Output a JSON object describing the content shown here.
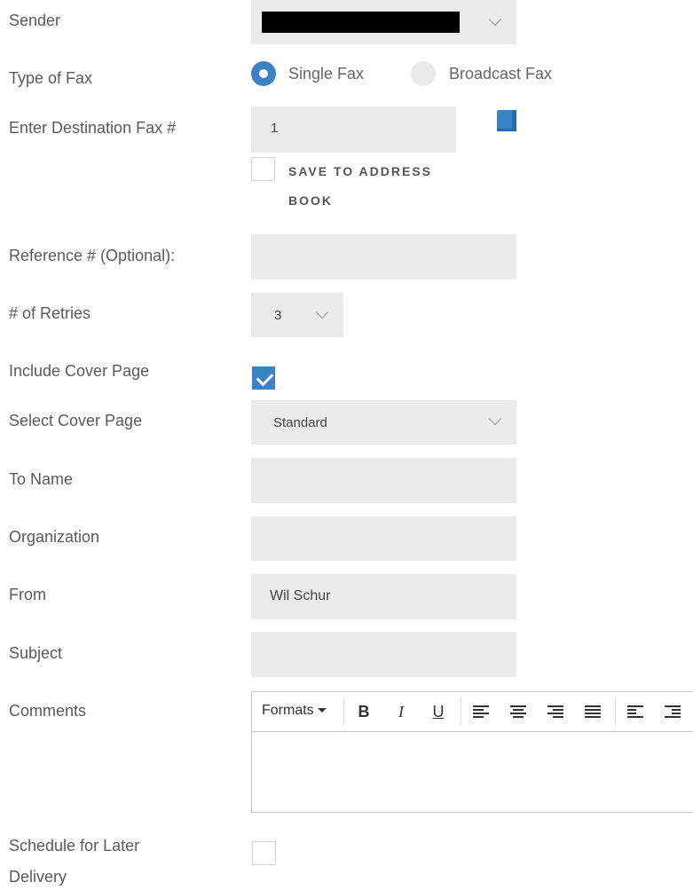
{
  "form": {
    "sender_label": "Sender",
    "fax_type_label": "Type of Fax",
    "single_fax_label": "Single Fax",
    "broadcast_fax_label": "Broadcast Fax",
    "destination_label": "Enter Destination Fax #",
    "destination_value": "1",
    "save_to_address_book_line1": "SAVE TO ADDRESS",
    "save_to_address_book_line2": "BOOK",
    "reference_label": "Reference # (Optional):",
    "reference_value": "",
    "retries_label": "# of Retries",
    "retries_value": "3",
    "include_cover_label": "Include Cover Page",
    "include_cover_checked": true,
    "select_cover_label": "Select Cover Page",
    "select_cover_value": "Standard",
    "to_name_label": "To Name",
    "to_name_value": "",
    "organization_label": "Organization",
    "organization_value": "",
    "from_label": "From",
    "from_value": "Wil Schur",
    "subject_label": "Subject",
    "subject_value": "",
    "comments_label": "Comments",
    "schedule_label_line1": "Schedule for Later",
    "schedule_label_line2": "Delivery",
    "schedule_checked": false
  },
  "editor_toolbar": {
    "formats_label": "Formats",
    "bold_label": "B",
    "italic_label": "I",
    "underline_label": "U"
  },
  "icons": {
    "address_book": "address-book-icon",
    "select_chevron": "chevron-down-icon"
  },
  "colors": {
    "accent": "#3b82c4",
    "field_bg": "#ebebeb",
    "label_text": "#5a5a5a"
  }
}
